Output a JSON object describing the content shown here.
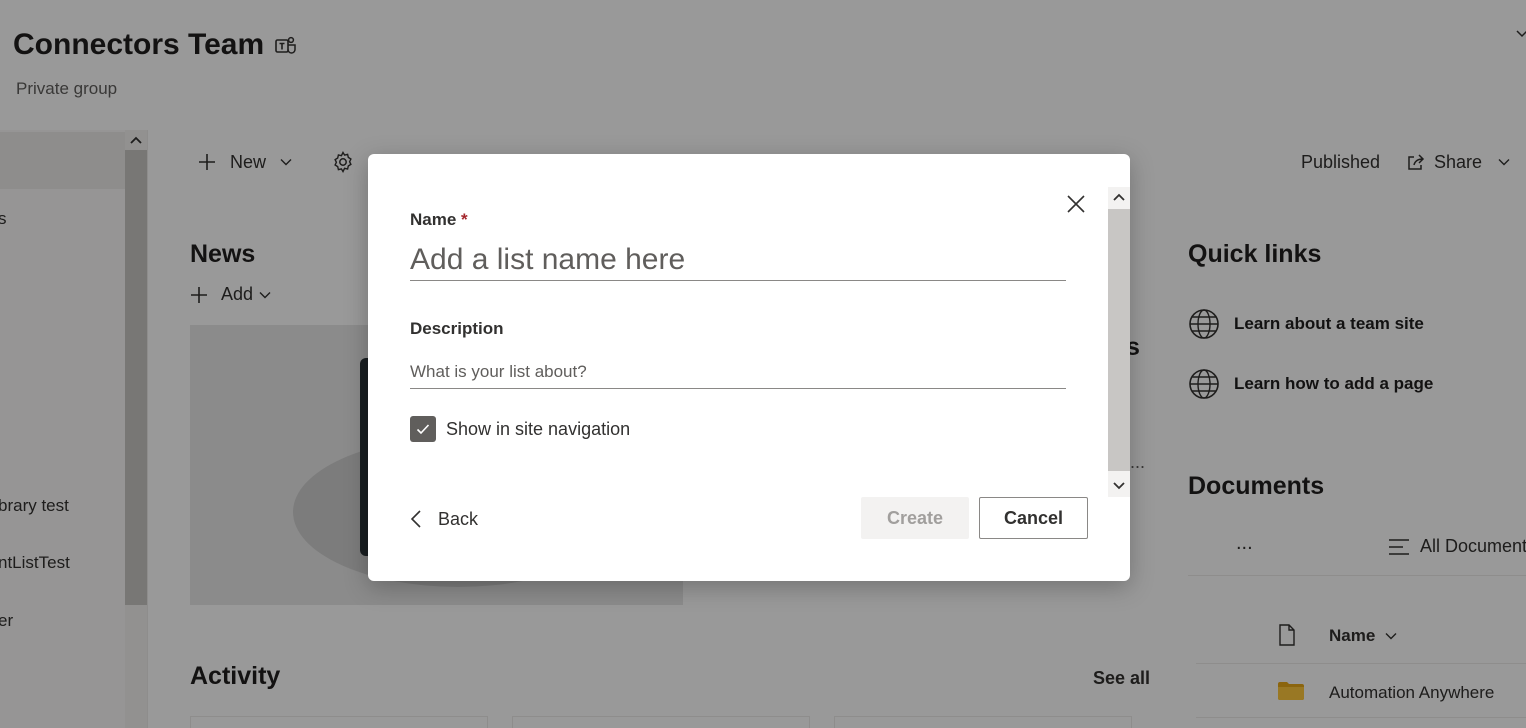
{
  "site": {
    "title": "Connectors Team",
    "subtitle": "Private group"
  },
  "leftnav": {
    "items": [
      {
        "label": "s"
      },
      {
        "label": "brary test"
      },
      {
        "label": "ntListTest"
      },
      {
        "label": "er"
      }
    ]
  },
  "commandbar": {
    "new_label": "New",
    "published_label": "Published",
    "share_label": "Share"
  },
  "news": {
    "title": "News",
    "add_label": "Add"
  },
  "activity": {
    "title": "Activity",
    "see_all_label": "See all"
  },
  "partial": {
    "heading_fragment": "s",
    "dots": "..."
  },
  "quick_links": {
    "title": "Quick links",
    "items": [
      {
        "label": "Learn about a team site"
      },
      {
        "label": "Learn how to add a page"
      }
    ]
  },
  "documents": {
    "title": "Documents",
    "more_label": "...",
    "view_label": "All Documents",
    "column_name": "Name",
    "rows": [
      {
        "name": "Automation Anywhere"
      }
    ]
  },
  "dialog": {
    "name_label": "Name",
    "required_mark": "*",
    "name_placeholder": "Add a list name here",
    "name_value": "",
    "description_label": "Description",
    "description_placeholder": "What is your list about?",
    "description_value": "",
    "show_in_nav_label": "Show in site navigation",
    "show_in_nav_checked": true,
    "back_label": "Back",
    "create_label": "Create",
    "cancel_label": "Cancel"
  },
  "colors": {
    "overlay": "#000000",
    "checkbox_fill": "#605e5c",
    "required": "#a4262c",
    "disabled_text": "#a19f9d"
  }
}
